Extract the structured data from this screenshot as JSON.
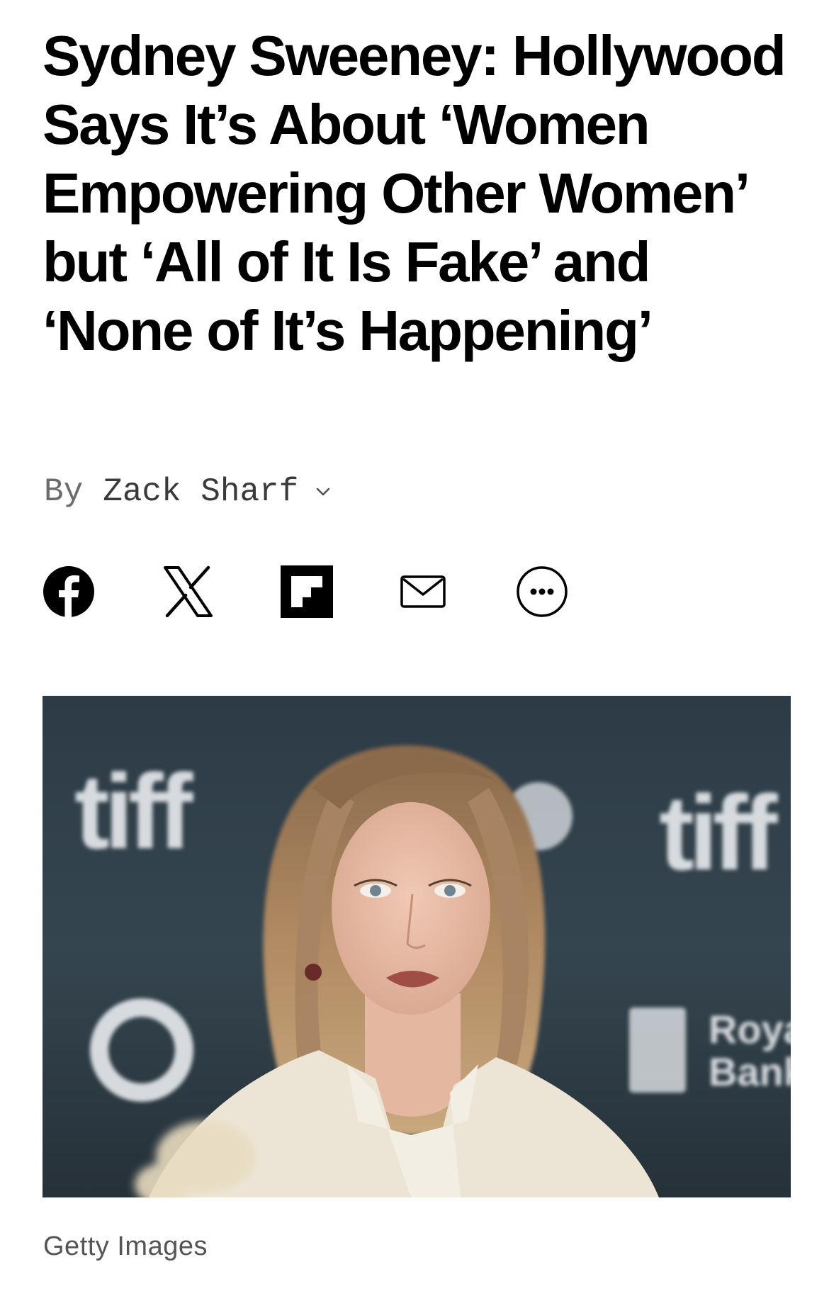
{
  "article": {
    "headline": "Sydney Sweeney: Hollywood Says It’s About ‘Women Empowering Other Women’ but ‘All of It Is Fake’ and ‘None of It’s Happening’",
    "byline": {
      "prefix": "By",
      "author": "Zack Sharf"
    },
    "share": [
      {
        "icon": "facebook-icon"
      },
      {
        "icon": "x-icon"
      },
      {
        "icon": "flipboard-icon"
      },
      {
        "icon": "mail-icon"
      },
      {
        "icon": "more-icon"
      }
    ],
    "image": {
      "backdrop_text_left": "tiff",
      "backdrop_text_right": "tiff",
      "sponsor_text_1": "Roya",
      "sponsor_text_2": "Bank",
      "credit": "Getty Images"
    }
  }
}
